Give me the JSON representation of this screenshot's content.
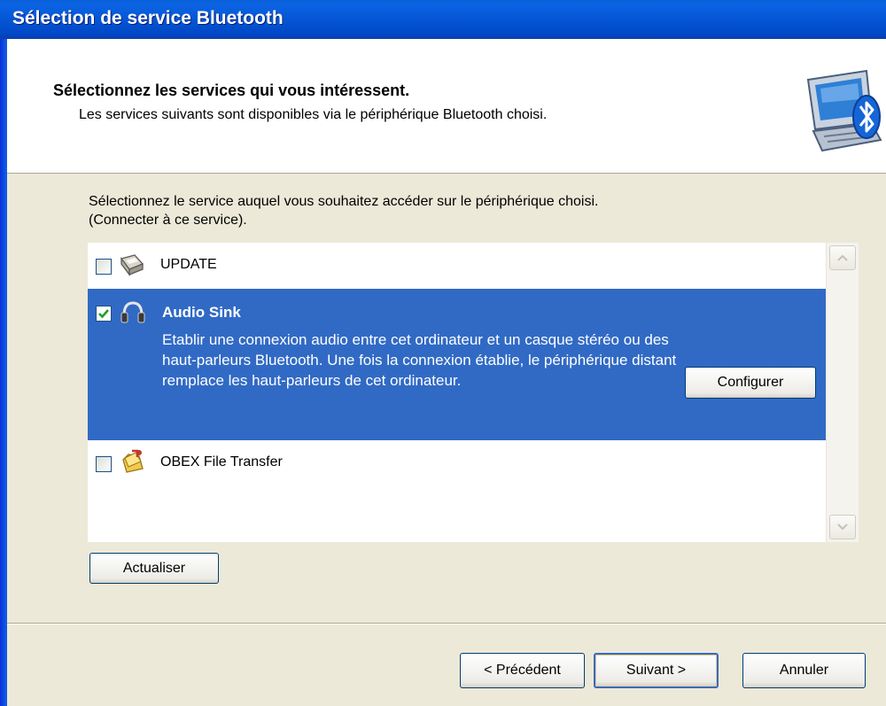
{
  "window": {
    "title": "Sélection de service Bluetooth"
  },
  "header": {
    "title": "Sélectionnez les services qui vous intéressent.",
    "subtitle": "Les services suivants sont disponibles via le périphérique Bluetooth choisi.",
    "icon": "bluetooth-computer-icon"
  },
  "intro": {
    "line1": "Sélectionnez le service auquel vous souhaitez accéder sur le périphérique choisi.",
    "line2": "(Connecter à ce service)."
  },
  "services": [
    {
      "name": "UPDATE",
      "checked": false,
      "icon": "update-service-icon"
    },
    {
      "name": "Audio Sink",
      "checked": true,
      "icon": "headphones-icon",
      "description": "Etablir une connexion audio entre cet ordinateur et un casque stéréo ou des haut-parleurs Bluetooth. Une fois la connexion établie, le périphérique distant remplace les haut-parleurs de cet ordinateur.",
      "configure_label": "Configurer"
    },
    {
      "name": "OBEX File Transfer",
      "checked": false,
      "icon": "obex-file-transfer-icon"
    }
  ],
  "refresh_label": "Actualiser",
  "footer": {
    "back_label": "< Précédent",
    "next_label": "Suivant >",
    "cancel_label": "Annuler"
  },
  "colors": {
    "selection": "#316ac5",
    "titlebar": "#0055e5",
    "dialog_bg": "#ece9d8"
  }
}
